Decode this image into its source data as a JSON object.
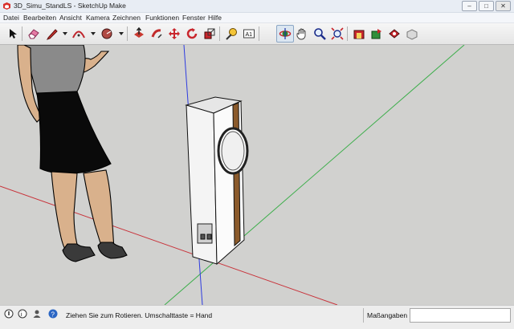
{
  "window": {
    "title": "3D_Simu_StandLS - SketchUp Make",
    "controls": [
      "–",
      "□",
      "✕"
    ]
  },
  "menubar": {
    "items": [
      "Datei",
      "Bearbeiten",
      "Ansicht",
      "Kamera",
      "Zeichnen",
      "Funktionen",
      "Fenster",
      "Hilfe"
    ]
  },
  "toolbar": {
    "tools": [
      {
        "name": "select-tool",
        "icon": "arrow-cursor-icon"
      },
      {
        "name": "eraser-tool",
        "icon": "eraser-icon"
      },
      {
        "name": "pencil-tool",
        "icon": "pencil-icon"
      },
      {
        "name": "arc-tool",
        "icon": "arc-icon"
      },
      {
        "name": "circle-tool",
        "icon": "circle-icon"
      },
      {
        "name": "push-pull-tool",
        "icon": "push-pull-icon"
      },
      {
        "name": "follow-me-tool",
        "icon": "follow-me-icon"
      },
      {
        "name": "move-tool",
        "icon": "move-icon"
      },
      {
        "name": "rotate-tool",
        "icon": "rotate-icon"
      },
      {
        "name": "scale-tool",
        "icon": "scale-icon"
      },
      {
        "name": "tape-measure-tool",
        "icon": "tape-measure-icon"
      },
      {
        "name": "text-tool",
        "icon": "text-label-icon",
        "text": "A1"
      },
      {
        "name": "orbit-tool",
        "icon": "orbit-icon",
        "active": true
      },
      {
        "name": "pan-tool",
        "icon": "hand-icon"
      },
      {
        "name": "zoom-tool",
        "icon": "magnifier-icon"
      },
      {
        "name": "zoom-extents-tool",
        "icon": "zoom-extents-icon"
      },
      {
        "name": "warehouse-tool",
        "icon": "warehouse-icon"
      },
      {
        "name": "share-model-tool",
        "icon": "share-model-icon"
      },
      {
        "name": "extension-warehouse-tool",
        "icon": "extension-warehouse-icon"
      },
      {
        "name": "share-component-tool",
        "icon": "share-component-icon"
      }
    ]
  },
  "statusbar": {
    "hint": "Ziehen Sie zum Rotieren.  Umschalttaste = Hand",
    "measure_label": "Maßangaben",
    "measure_value": ""
  },
  "colors": {
    "viewport_bg": "#d1d1cf",
    "axis_red": "#c8323a",
    "axis_green": "#3dae4b",
    "axis_blue": "#2d3be0",
    "speaker_wood": "#8b5a2b"
  }
}
